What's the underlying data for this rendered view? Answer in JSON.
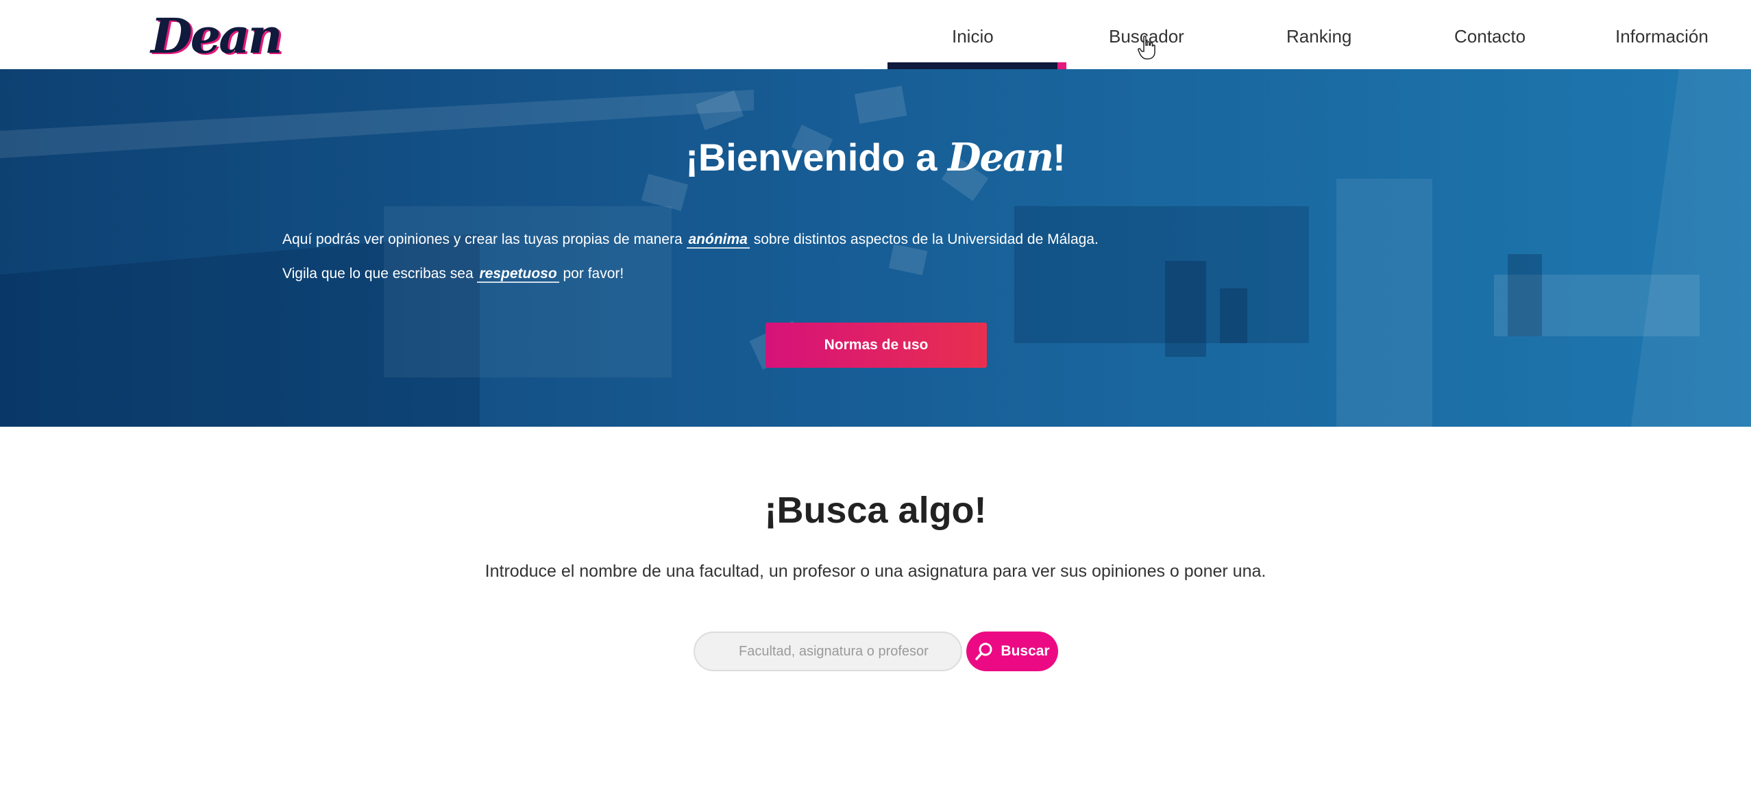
{
  "nav": {
    "logo": "Dean",
    "items": [
      {
        "label": "Inicio"
      },
      {
        "label": "Buscador"
      },
      {
        "label": "Ranking"
      },
      {
        "label": "Contacto"
      },
      {
        "label": "Información"
      }
    ],
    "active_item": "Inicio"
  },
  "hero": {
    "title_prefix": "¡Bienvenido a ",
    "title_brand": "Dean",
    "title_suffix": "!",
    "line1_before": "Aquí podrás ver opiniones y crear las tuyas propias de manera ",
    "line1_em": "anónima",
    "line1_after": " sobre distintos aspectos de la Universidad de Málaga.",
    "line2_before": "Vigila que lo que escribas sea ",
    "line2_em": "respetuoso",
    "line2_after": " por favor!",
    "button_label": "Normas de uso"
  },
  "search": {
    "title": "¡Busca algo!",
    "description": "Introduce el nombre de una facultad, un profesor o una asignatura para ver sus opiniones o poner una.",
    "placeholder": "Facultad, asignatura o profesor",
    "value": "",
    "button_label": "Buscar",
    "button_icon": "search-icon"
  },
  "colors": {
    "brand_dark": "#0f1a3c",
    "accent_pink": "#ec0a84",
    "hero_blue": "#1f5e8c"
  }
}
